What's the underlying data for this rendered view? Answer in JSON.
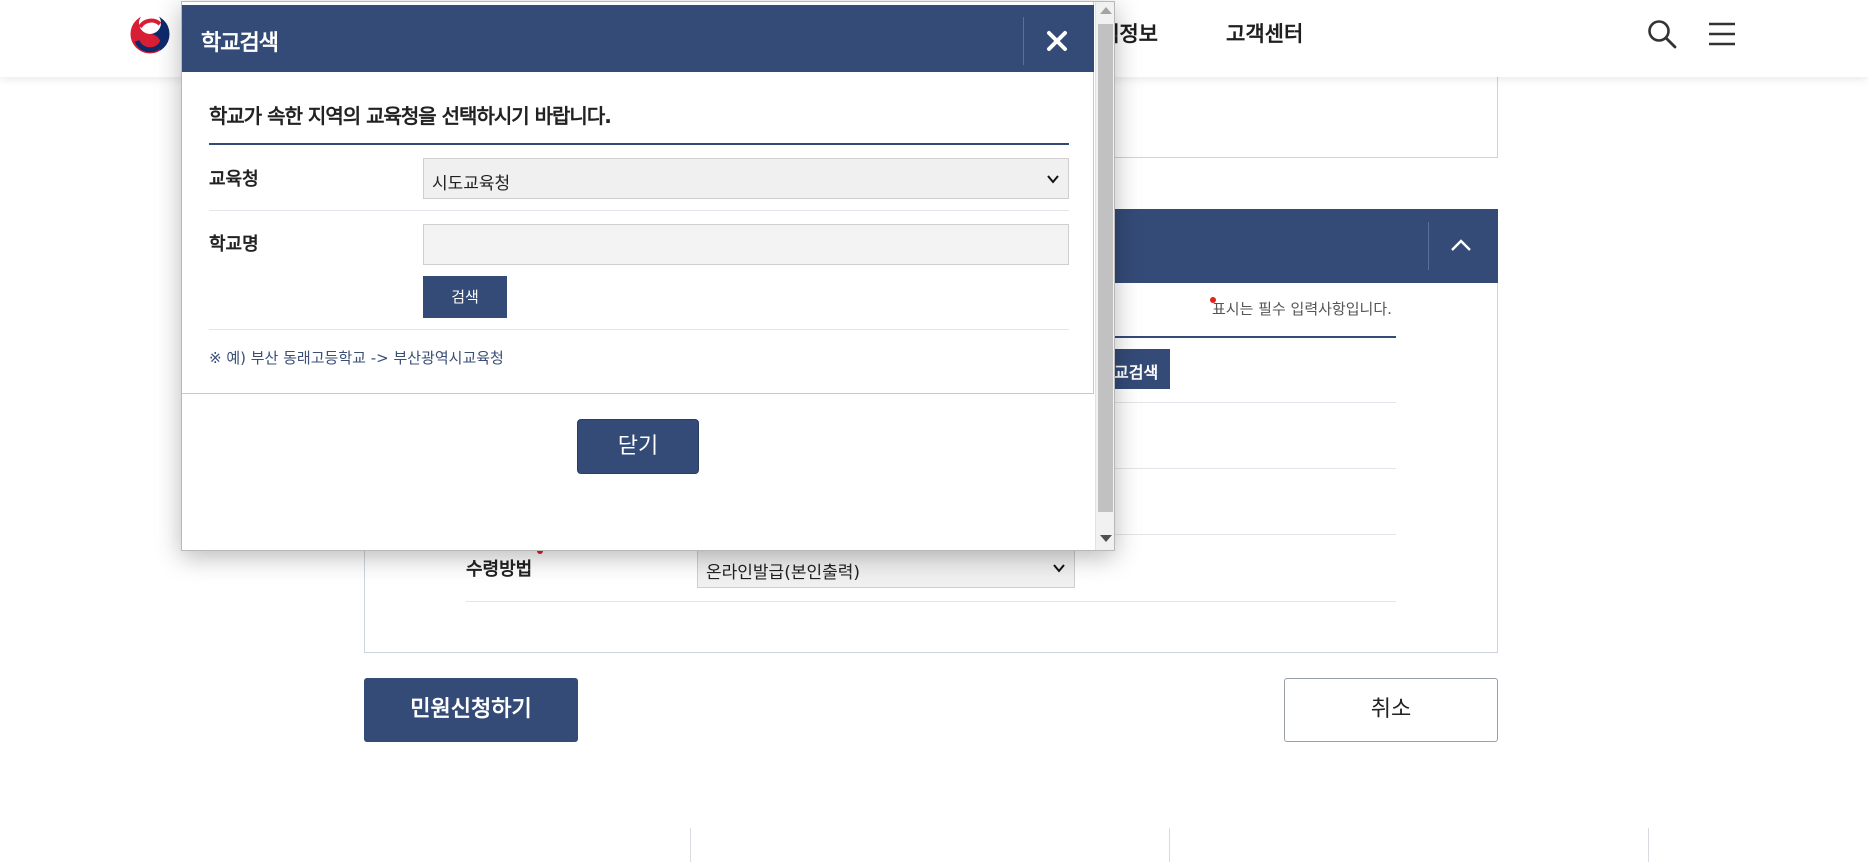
{
  "header": {
    "nav_partial": "책정보",
    "nav_customer": "고객센터",
    "logo_icon": "taegeuk-emblem-icon",
    "search_icon": "search-icon",
    "menu_icon": "hamburger-menu-icon"
  },
  "form": {
    "required_note": "표시는 필수 입력사항입니다.",
    "school_search_button": "교검색",
    "receive_label": "수령방법",
    "receive_value": "온라인발급(본인출력)",
    "apply_button": "민원신청하기",
    "cancel_button": "취소"
  },
  "footer": {
    "col1": "",
    "col2": "",
    "col3": ""
  },
  "popup": {
    "title": "학교검색",
    "guide": "학교가 속한 지역의 교육청을 선택하시기 바랍니다.",
    "office_label": "교육청",
    "office_value": "시도교육청",
    "school_label": "학교명",
    "school_value": "",
    "search_button": "검색",
    "example": "※ 예) 부산 동래고등학교 -> 부산광역시교육청",
    "close_button": "닫기"
  },
  "colors": {
    "primary": "#344b77",
    "required": "#e2231a"
  }
}
